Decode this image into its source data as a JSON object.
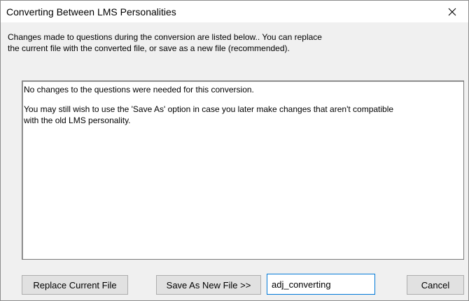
{
  "dialog": {
    "title": "Converting Between LMS Personalities",
    "close_icon": "close-icon",
    "instructions": {
      "line1": "Changes made to questions during the conversion are listed below..  You can replace",
      "line2": "the current file with the converted file, or save as a new file (recommended)."
    },
    "changes": {
      "paragraph1": "No changes to the questions were needed for this conversion.",
      "paragraph2_line1": "You may still wish to use the 'Save As' option in case you later make changes that aren't compatible",
      "paragraph2_line2": "with the old LMS personality."
    },
    "buttons": {
      "replace_label": "Replace Current File",
      "save_as_label": "Save As New File >>",
      "cancel_label": "Cancel"
    },
    "filename_input": {
      "value": "adj_converting"
    }
  }
}
